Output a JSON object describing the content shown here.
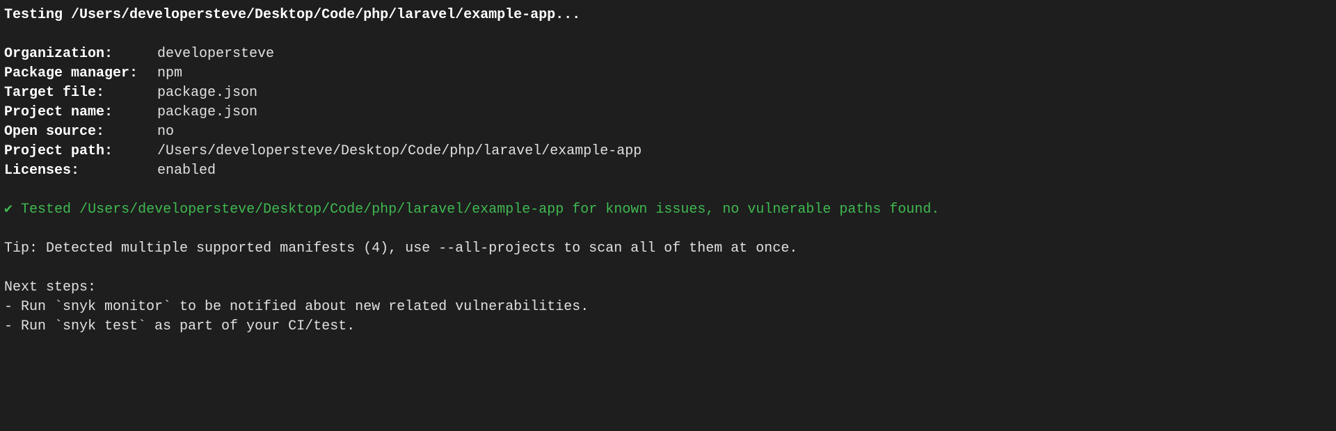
{
  "header": {
    "testing_line": "Testing /Users/developersteve/Desktop/Code/php/laravel/example-app..."
  },
  "details": {
    "organization": {
      "label": "Organization:",
      "value": "developersteve"
    },
    "package_manager": {
      "label": "Package manager:",
      "value": "npm"
    },
    "target_file": {
      "label": "Target file:",
      "value": "package.json"
    },
    "project_name": {
      "label": "Project name:",
      "value": "package.json"
    },
    "open_source": {
      "label": "Open source:",
      "value": "no"
    },
    "project_path": {
      "label": "Project path:",
      "value": "/Users/developersteve/Desktop/Code/php/laravel/example-app"
    },
    "licenses": {
      "label": "Licenses:",
      "value": "enabled"
    }
  },
  "result": {
    "check": "✔",
    "text": " Tested /Users/developersteve/Desktop/Code/php/laravel/example-app for known issues, no vulnerable paths found."
  },
  "tip": {
    "label": "Tip:",
    "text": " Detected multiple supported manifests (4), use --all-projects to scan all of them at once."
  },
  "next_steps": {
    "heading": "Next steps:",
    "items": [
      "- Run `snyk monitor` to be notified about new related vulnerabilities.",
      "- Run `snyk test` as part of your CI/test."
    ]
  }
}
